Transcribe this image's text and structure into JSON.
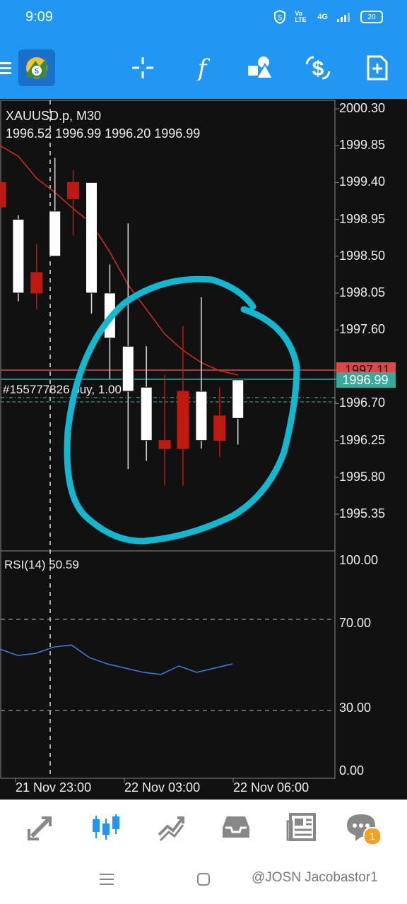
{
  "status_bar": {
    "time": "9:09",
    "battery": "20",
    "network": "4G",
    "volte": "Vo LTE"
  },
  "toolbar": {
    "menu_icon": "hamburger-icon",
    "app_icon": "mt5-logo-icon",
    "buttons": [
      "crosshair-icon",
      "indicators-f-icon",
      "objects-shapes-icon",
      "symbol-dollar-icon",
      "new-order-icon"
    ]
  },
  "chart": {
    "symbol": "XAUUSD.p, M30",
    "ohlc": "1996.52 1996.99 1996.20 1996.99",
    "price_labels": [
      "2000.30",
      "1999.85",
      "1999.40",
      "1998.95",
      "1998.50",
      "1998.05",
      "1997.60",
      "1996.70",
      "1996.25",
      "1995.80",
      "1995.35"
    ],
    "red_line_label": "1997.11",
    "bid_label": "1996.99",
    "order_label": "#155777826 buy, 1.00",
    "rsi_label": "RSI(14) 50.59",
    "rsi_levels": [
      "100.00",
      "70.00",
      "30.00",
      "0.00"
    ],
    "time_labels": [
      "21 Nov 23:00",
      "22 Nov 03:00",
      "22 Nov 06:00"
    ]
  },
  "chart_data": {
    "type": "candlestick",
    "symbol": "XAUUSD.p",
    "timeframe": "M30",
    "ylim": [
      1995.0,
      2000.4
    ],
    "candles": [
      {
        "o": 1999.4,
        "h": 1999.4,
        "l": 1999.1,
        "c": 1999.1
      },
      {
        "o": 1998.05,
        "h": 1999.0,
        "l": 1997.95,
        "c": 1998.95
      },
      {
        "o": 1998.3,
        "h": 1998.65,
        "l": 1997.85,
        "c": 1998.05
      },
      {
        "o": 1998.5,
        "h": 1999.7,
        "l": 1998.5,
        "c": 1999.05
      },
      {
        "o": 1999.4,
        "h": 1999.55,
        "l": 1998.75,
        "c": 1999.2
      },
      {
        "o": 1998.05,
        "h": 1999.4,
        "l": 1997.8,
        "c": 1999.4
      },
      {
        "o": 1997.5,
        "h": 1998.4,
        "l": 1997.0,
        "c": 1998.05
      },
      {
        "o": 1996.85,
        "h": 1998.9,
        "l": 1995.9,
        "c": 1997.4
      },
      {
        "o": 1996.25,
        "h": 1997.4,
        "l": 1996.0,
        "c": 1996.9
      },
      {
        "o": 1996.25,
        "h": 1997.05,
        "l": 1995.7,
        "c": 1996.15
      },
      {
        "o": 1996.85,
        "h": 1997.65,
        "l": 1995.7,
        "c": 1996.15
      },
      {
        "o": 1996.25,
        "h": 1998.0,
        "l": 1996.15,
        "c": 1996.85
      },
      {
        "o": 1996.55,
        "h": 1996.9,
        "l": 1996.05,
        "c": 1996.25
      },
      {
        "o": 1996.52,
        "h": 1996.99,
        "l": 1996.2,
        "c": 1996.99
      }
    ],
    "ma": [
      1999.85,
      1999.72,
      1999.45,
      1999.28,
      1999.08,
      1998.9,
      1998.55,
      1998.15,
      1997.85,
      1997.55,
      1997.35,
      1997.2,
      1997.1,
      1997.05
    ],
    "rsi": [
      58,
      55,
      56,
      59,
      60,
      54,
      51,
      49,
      47,
      46,
      50,
      47,
      49,
      51
    ],
    "rsi_ylim": [
      0,
      100
    ],
    "levels": {
      "red_line": 1997.11,
      "bid": 1996.99,
      "order": 1996.8
    },
    "colors": {
      "bull": "#ffffff",
      "bear": "#c0190f",
      "ma": "#d92b20",
      "rsi": "#3b82e0",
      "bid": "#3aa89a",
      "annotation": "#12b8cf"
    }
  },
  "bottom_nav": {
    "items": [
      "quotes-arrows-icon",
      "chart-candles-icon",
      "trade-icon",
      "history-inbox-icon",
      "news-icon",
      "messages-chat-icon"
    ],
    "badge": "1"
  },
  "system_nav": {
    "items": [
      "menu-lines-icon",
      "home-square-icon"
    ],
    "watermark": "@JOSN Jacobastor1"
  },
  "colors": {
    "accent": "#2196f3",
    "active_nav": "#2196f3"
  }
}
